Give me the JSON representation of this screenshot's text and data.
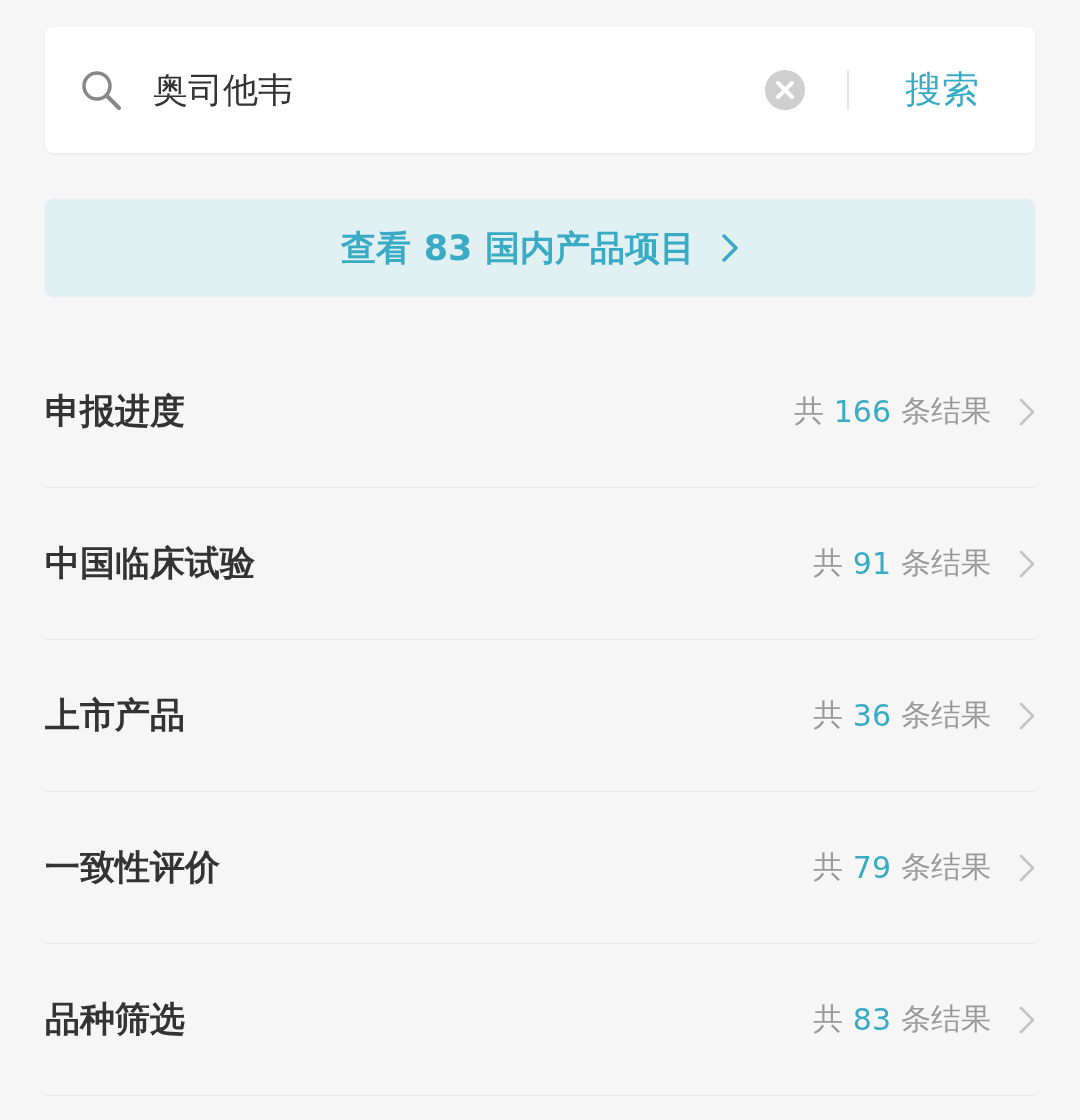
{
  "search": {
    "value": "奥司他韦",
    "button": "搜索"
  },
  "banner": {
    "label": "查看 83 国内产品项目"
  },
  "categories": [
    {
      "title": "申报进度",
      "prefix": "共",
      "count": "166",
      "suffix": "条结果"
    },
    {
      "title": "中国临床试验",
      "prefix": "共",
      "count": "91",
      "suffix": "条结果"
    },
    {
      "title": "上市产品",
      "prefix": "共",
      "count": "36",
      "suffix": "条结果"
    },
    {
      "title": "一致性评价",
      "prefix": "共",
      "count": "79",
      "suffix": "条结果"
    },
    {
      "title": "品种筛选",
      "prefix": "共",
      "count": "83",
      "suffix": "条结果"
    }
  ]
}
